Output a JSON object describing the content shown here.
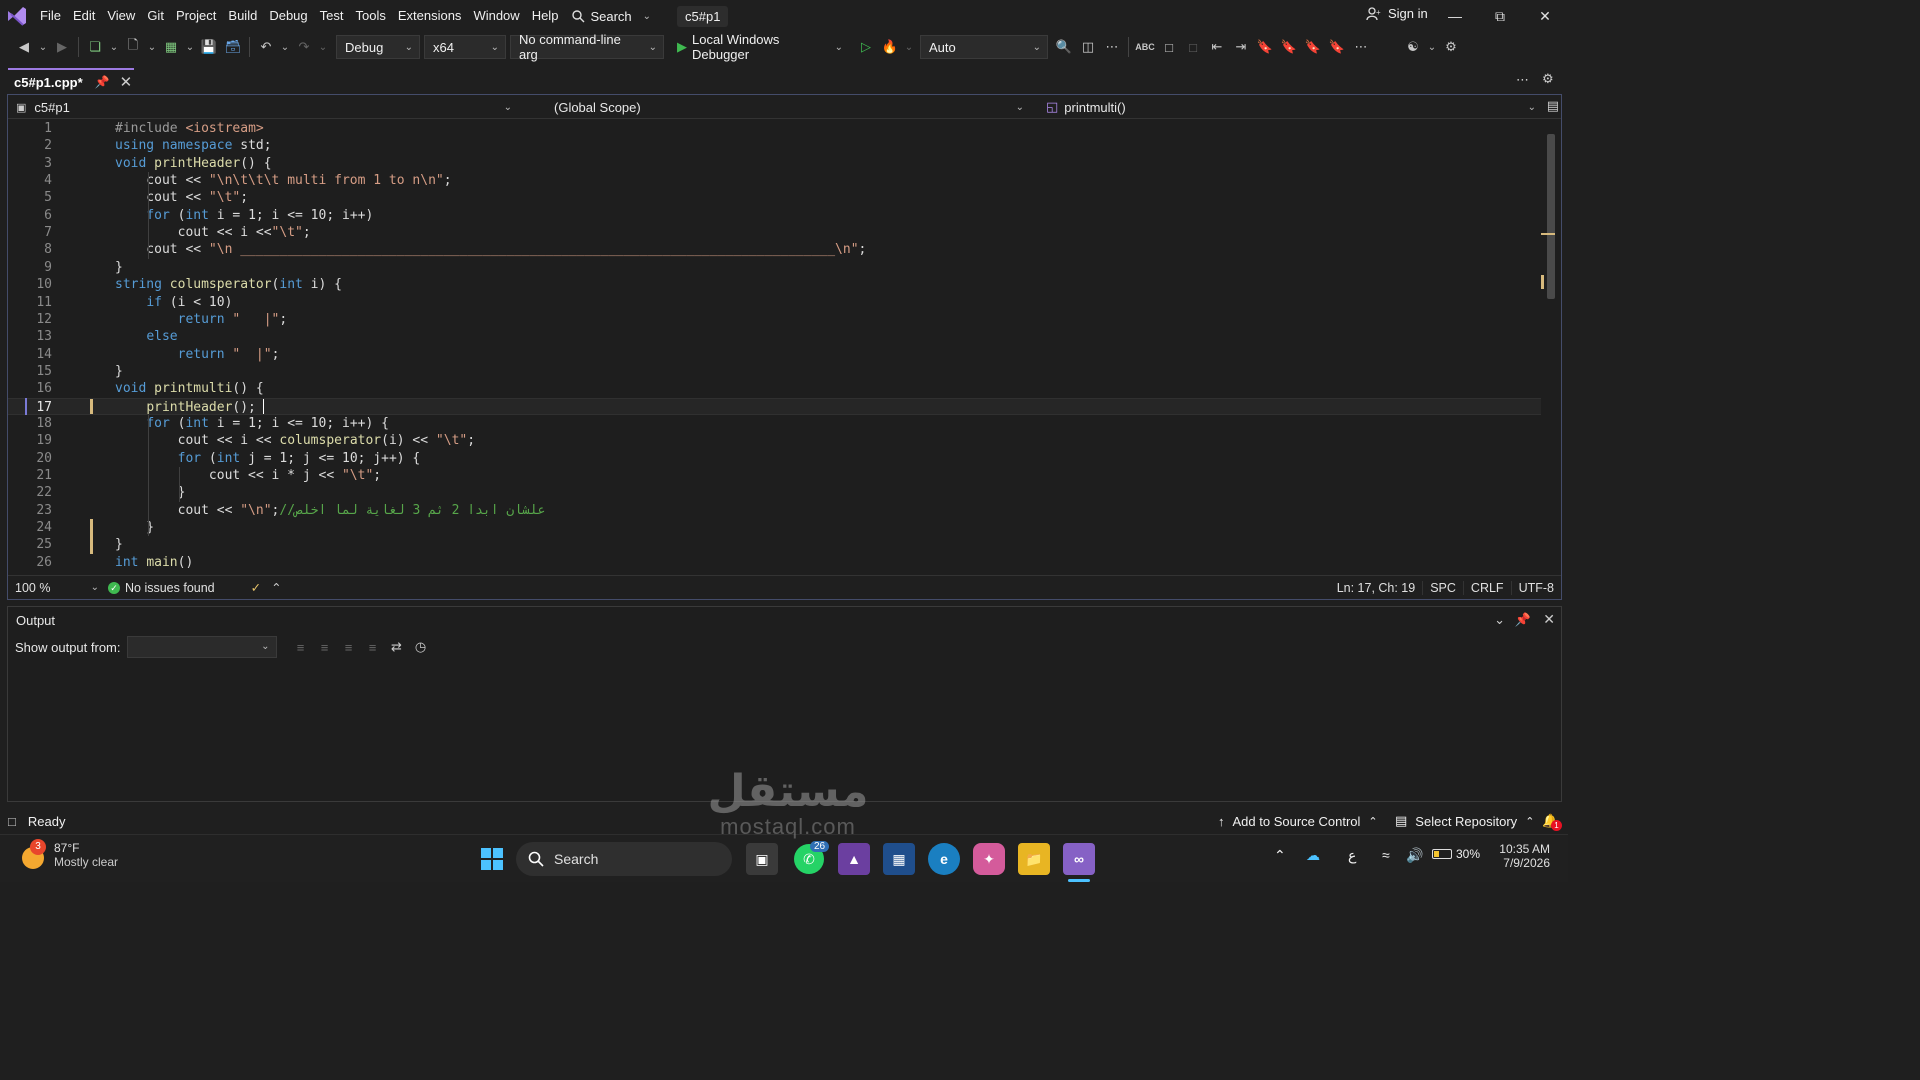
{
  "menu": {
    "items": [
      "File",
      "Edit",
      "View",
      "Git",
      "Project",
      "Build",
      "Debug",
      "Test",
      "Tools",
      "Extensions",
      "Window",
      "Help"
    ],
    "search_label": "Search",
    "solution_name": "c5#p1",
    "sign_in": "Sign in"
  },
  "toolbar": {
    "configuration": "Debug",
    "platform": "x64",
    "command_args": "No command-line arg",
    "debugger": "Local Windows Debugger",
    "mode": "Auto"
  },
  "tab": {
    "title": "c5#p1.cpp*"
  },
  "navbar": {
    "project": "c5#p1",
    "scope": "(Global Scope)",
    "member": "printmulti()"
  },
  "code_lines": [
    {
      "n": "1",
      "t": "#include <iostream>"
    },
    {
      "n": "2",
      "t": "using namespace std;"
    },
    {
      "n": "3",
      "t": "void printHeader() {"
    },
    {
      "n": "4",
      "t": "    cout << \"\\n\\t\\t\\t multi from 1 to n\\n\";"
    },
    {
      "n": "5",
      "t": "    cout << \"\\t\";"
    },
    {
      "n": "6",
      "t": "    for (int i = 1; i <= 10; i++)"
    },
    {
      "n": "7",
      "t": "        cout << i <<\"\\t\";"
    },
    {
      "n": "8",
      "t": "    cout << \"\\n ____________________________________________________________________________\\n\";"
    },
    {
      "n": "9",
      "t": "}"
    },
    {
      "n": "10",
      "t": "string columsperator(int i) {"
    },
    {
      "n": "11",
      "t": "    if (i < 10)"
    },
    {
      "n": "12",
      "t": "        return \"   |\";"
    },
    {
      "n": "13",
      "t": "    else"
    },
    {
      "n": "14",
      "t": "        return \"  |\";"
    },
    {
      "n": "15",
      "t": "}"
    },
    {
      "n": "16",
      "t": "void printmulti() {"
    },
    {
      "n": "17",
      "t": "    printHeader();"
    },
    {
      "n": "18",
      "t": "    for (int i = 1; i <= 10; i++) {"
    },
    {
      "n": "19",
      "t": "        cout << i << columsperator(i) << \"\\t\";"
    },
    {
      "n": "20",
      "t": "        for (int j = 1; j <= 10; j++) {"
    },
    {
      "n": "21",
      "t": "            cout << i * j << \"\\t\";"
    },
    {
      "n": "22",
      "t": "        }"
    },
    {
      "n": "23",
      "t": "        cout << \"\\n\";//علشان ابدا 2 ثم 3 لغاية لما اخلص"
    },
    {
      "n": "24",
      "t": "    }"
    },
    {
      "n": "25",
      "t": "}"
    },
    {
      "n": "26",
      "t": "int main()"
    }
  ],
  "editor_status": {
    "zoom": "100 %",
    "issues": "No issues found",
    "position": "Ln: 17, Ch: 19",
    "whitespace": "SPC",
    "line_endings": "CRLF",
    "encoding": "UTF-8"
  },
  "output": {
    "title": "Output",
    "show_from_label": "Show output from:"
  },
  "statusbar": {
    "state": "Ready",
    "source_control": "Add to Source Control",
    "repository": "Select Repository"
  },
  "taskbar": {
    "weather_temp": "87°F",
    "weather_desc": "Mostly clear",
    "weather_badge": "3",
    "search": "Search",
    "whatsapp_badge": "26",
    "battery": "30%",
    "time": "10:35 AM",
    "date": "7/9/2026",
    "lang": "ع",
    "notif_badge": "1"
  },
  "watermark": {
    "text_ar": "مستقل",
    "text_en": "mostaql.com"
  },
  "colors": {
    "accent": "#9d7ae2",
    "keyword": "#569cd6",
    "string": "#d69d85",
    "function": "#dcdcaa",
    "comment": "#57a64a",
    "ok_green": "#3fb950"
  }
}
